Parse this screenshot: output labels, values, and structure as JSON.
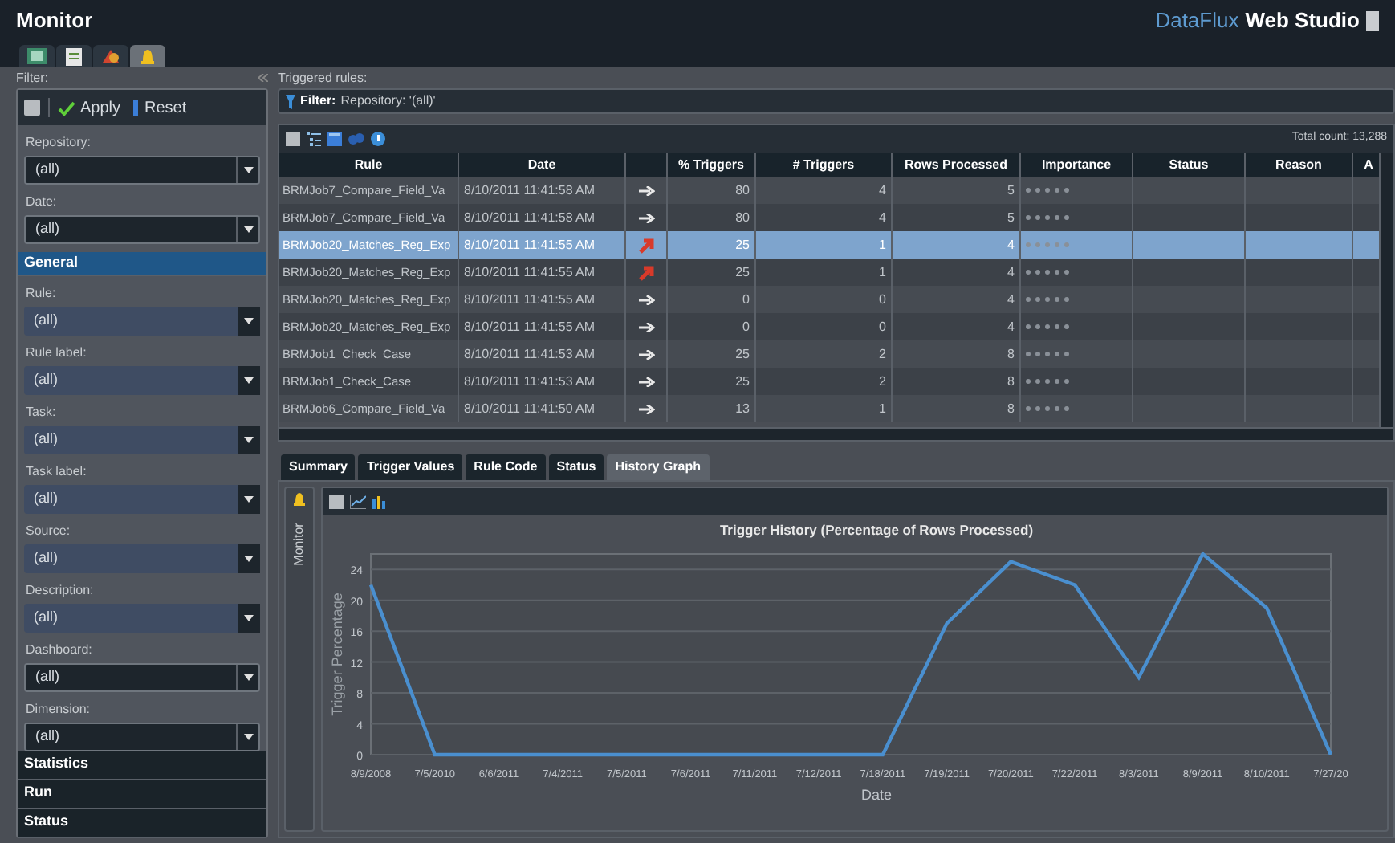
{
  "window": {
    "title": "Monitor",
    "brand_light": "DataFlux",
    "brand_bold": "Web Studio"
  },
  "app_tabs": [
    {
      "selected": false
    },
    {
      "selected": false
    },
    {
      "selected": false
    },
    {
      "selected": true
    }
  ],
  "filter_panel": {
    "title": "Filter:",
    "toolbar": {
      "apply": "Apply",
      "reset": "Reset"
    },
    "top_filters": [
      {
        "label": "Repository:",
        "value": "(all)",
        "kind": "dark"
      },
      {
        "label": "Date:",
        "value": "(all)",
        "kind": "dark"
      }
    ],
    "sections": [
      {
        "title": "General",
        "expanded": true,
        "filters": [
          {
            "label": "Rule:",
            "value": "(all)",
            "kind": "blue"
          },
          {
            "label": "Rule label:",
            "value": "(all)",
            "kind": "blue"
          },
          {
            "label": "Task:",
            "value": "(all)",
            "kind": "blue"
          },
          {
            "label": "Task label:",
            "value": "(all)",
            "kind": "blue"
          },
          {
            "label": "Source:",
            "value": "(all)",
            "kind": "blue"
          },
          {
            "label": "Description:",
            "value": "(all)",
            "kind": "blue"
          },
          {
            "label": "Dashboard:",
            "value": "(all)",
            "kind": "dark"
          },
          {
            "label": "Dimension:",
            "value": "(all)",
            "kind": "dark"
          }
        ]
      },
      {
        "title": "Statistics",
        "expanded": false
      },
      {
        "title": "Run",
        "expanded": false
      },
      {
        "title": "Status",
        "expanded": false
      }
    ]
  },
  "triggered_rules": {
    "title": "Triggered rules:",
    "filter_label": "Filter:",
    "filter_text": "Repository: '(all)'",
    "total_count": "Total count: 13,288",
    "table": {
      "columns": [
        "Rule",
        "Date",
        "",
        "% Triggers",
        "# Triggers",
        "Rows Processed",
        "Importance",
        "Status",
        "Reason",
        "A"
      ],
      "rows": [
        {
          "rule": "BRMJob7_Compare_Field_Va",
          "date": "8/10/2011 11:41:58 AM",
          "kind": "flat",
          "pct": "80",
          "triggers": "4",
          "rows": "5",
          "stars": 0,
          "selected": false
        },
        {
          "rule": "BRMJob7_Compare_Field_Va",
          "date": "8/10/2011 11:41:58 AM",
          "kind": "flat",
          "pct": "80",
          "triggers": "4",
          "rows": "5",
          "stars": 0,
          "selected": false
        },
        {
          "rule": "BRMJob20_Matches_Reg_Exp",
          "date": "8/10/2011 11:41:55 AM",
          "kind": "up",
          "pct": "25",
          "triggers": "1",
          "rows": "4",
          "stars": 0,
          "selected": true
        },
        {
          "rule": "BRMJob20_Matches_Reg_Exp",
          "date": "8/10/2011 11:41:55 AM",
          "kind": "up",
          "pct": "25",
          "triggers": "1",
          "rows": "4",
          "stars": 0,
          "selected": false
        },
        {
          "rule": "BRMJob20_Matches_Reg_Exp",
          "date": "8/10/2011 11:41:55 AM",
          "kind": "flat",
          "pct": "0",
          "triggers": "0",
          "rows": "4",
          "stars": 0,
          "selected": false
        },
        {
          "rule": "BRMJob20_Matches_Reg_Exp",
          "date": "8/10/2011 11:41:55 AM",
          "kind": "flat",
          "pct": "0",
          "triggers": "0",
          "rows": "4",
          "stars": 0,
          "selected": false
        },
        {
          "rule": "BRMJob1_Check_Case",
          "date": "8/10/2011 11:41:53 AM",
          "kind": "flat",
          "pct": "25",
          "triggers": "2",
          "rows": "8",
          "stars": 0,
          "selected": false
        },
        {
          "rule": "BRMJob1_Check_Case",
          "date": "8/10/2011 11:41:53 AM",
          "kind": "flat",
          "pct": "25",
          "triggers": "2",
          "rows": "8",
          "stars": 0,
          "selected": false
        },
        {
          "rule": "BRMJob6_Compare_Field_Va",
          "date": "8/10/2011 11:41:50 AM",
          "kind": "flat",
          "pct": "13",
          "triggers": "1",
          "rows": "8",
          "stars": 0,
          "selected": false
        }
      ]
    }
  },
  "detail_tabs": [
    {
      "label": "Summary",
      "selected": false
    },
    {
      "label": "Trigger Values",
      "selected": false
    },
    {
      "label": "Rule Code",
      "selected": false
    },
    {
      "label": "Status",
      "selected": false
    },
    {
      "label": "History Graph",
      "selected": true
    }
  ],
  "side_strip": {
    "label": "Monitor"
  },
  "chart": {
    "chart_data": {
      "type": "line",
      "title": "Trigger History (Percentage of Rows Processed)",
      "xlabel": "Date",
      "ylabel": "Trigger Percentage",
      "categories": [
        "8/9/2008",
        "7/5/2010",
        "6/6/2011",
        "7/4/2011",
        "7/5/2011",
        "7/6/2011",
        "7/11/2011",
        "7/12/2011",
        "7/18/2011",
        "7/19/2011",
        "7/20/2011",
        "7/22/2011",
        "8/3/2011",
        "8/9/2011",
        "8/10/2011",
        "7/27/20"
      ],
      "grid": true,
      "series": [
        {
          "color": "#4a8fcf",
          "values": [
            22,
            0,
            0,
            0,
            0,
            0,
            0,
            0,
            0,
            17,
            25,
            22,
            10,
            26,
            19,
            0
          ]
        }
      ],
      "ylim": [
        0,
        26
      ],
      "yticks": [
        0,
        4,
        8,
        12,
        16,
        20,
        24
      ]
    }
  }
}
